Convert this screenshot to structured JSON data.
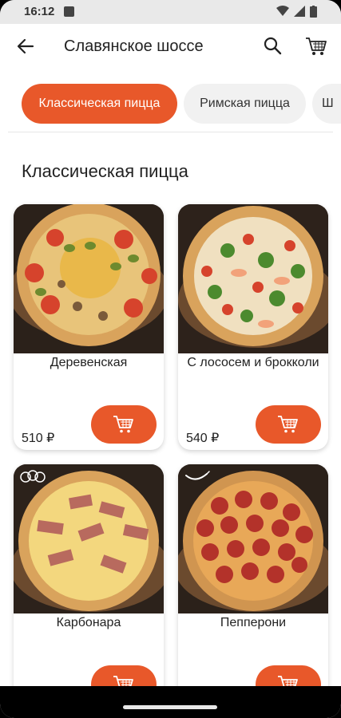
{
  "status_bar": {
    "time": "16:12"
  },
  "header": {
    "title": "Славянское шоссе"
  },
  "categories": [
    {
      "label": "Классическая пицца",
      "active": true
    },
    {
      "label": "Римская пицца",
      "active": false
    },
    {
      "label": "Ш",
      "active": false
    }
  ],
  "section": {
    "title": "Классическая пицца"
  },
  "products": [
    {
      "name": "Деревенская",
      "price": "510 ₽",
      "image": "pizza-derevenskaya"
    },
    {
      "name": "С лососем и брокколи",
      "price": "540 ₽",
      "image": "pizza-salmon-broccoli"
    },
    {
      "name": "Карбонара",
      "price": "",
      "image": "pizza-carbonara",
      "badge": "vegetarian-icon"
    },
    {
      "name": "Пепперони",
      "price": "",
      "image": "pizza-pepperoni",
      "badge": "chili-icon"
    }
  ],
  "colors": {
    "accent": "#e8582a",
    "chip_bg": "#f1f1f1"
  }
}
